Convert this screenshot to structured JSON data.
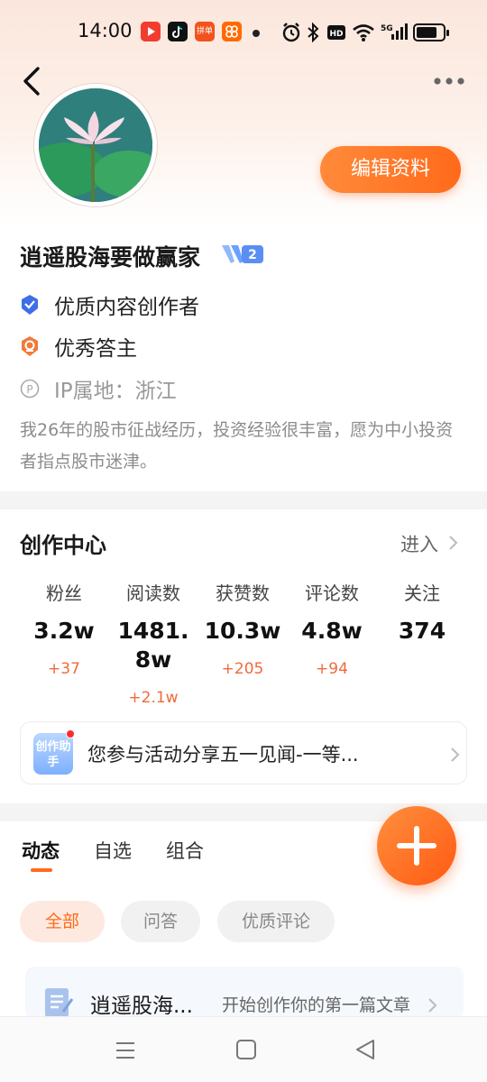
{
  "status_bar": {
    "time": "14:00",
    "app_icons": [
      "video-app-icon",
      "tiktok-icon",
      "shopping-app-icon",
      "camera-app-icon"
    ],
    "app_icon_text": "拼单",
    "signal_label": "5G",
    "system_icons": [
      "alarm-icon",
      "bluetooth-icon",
      "hd-icon",
      "wifi-icon",
      "signal-icon",
      "battery-icon"
    ]
  },
  "header": {
    "back_icon": "chevron-left-icon",
    "more_icon": "more-dots-icon",
    "edit_button_label": "编辑资料"
  },
  "profile": {
    "name": "逍遥股海要做赢家",
    "level": "2",
    "honors": [
      {
        "icon": "quality-creator-badge-icon",
        "label": "优质内容创作者"
      },
      {
        "icon": "excellent-answerer-badge-icon",
        "label": "优秀答主"
      }
    ],
    "ip_location": "IP属地：浙江",
    "bio": "我26年的股市征战经历，投资经验很丰富，愿为中小投资者指点股市迷津。"
  },
  "creation_center": {
    "title": "创作中心",
    "enter_label": "进入",
    "stats": [
      {
        "label": "粉丝",
        "value": "3.2w",
        "delta": "+37"
      },
      {
        "label": "阅读数",
        "value": "1481.8w",
        "delta": "+2.1w"
      },
      {
        "label": "获赞数",
        "value": "10.3w",
        "delta": "+205"
      },
      {
        "label": "评论数",
        "value": "4.8w",
        "delta": "+94"
      },
      {
        "label": "关注",
        "value": "374",
        "delta": ""
      }
    ],
    "activity": {
      "icon_text": "创作助手",
      "text": "您参与活动分享五一见闻-一等..."
    }
  },
  "tabs": [
    {
      "label": "动态",
      "active": true
    },
    {
      "label": "自选",
      "active": false
    },
    {
      "label": "组合",
      "active": false
    }
  ],
  "filters": [
    {
      "label": "全部",
      "active": true
    },
    {
      "label": "问答",
      "active": false
    },
    {
      "label": "优质评论",
      "active": false
    }
  ],
  "article_card": {
    "name": "逍遥股海...",
    "hint": "开始创作你的第一篇文章"
  },
  "colors": {
    "accent": "#ff6a1a",
    "delta": "#ee6b3a",
    "muted_text": "#999999"
  }
}
